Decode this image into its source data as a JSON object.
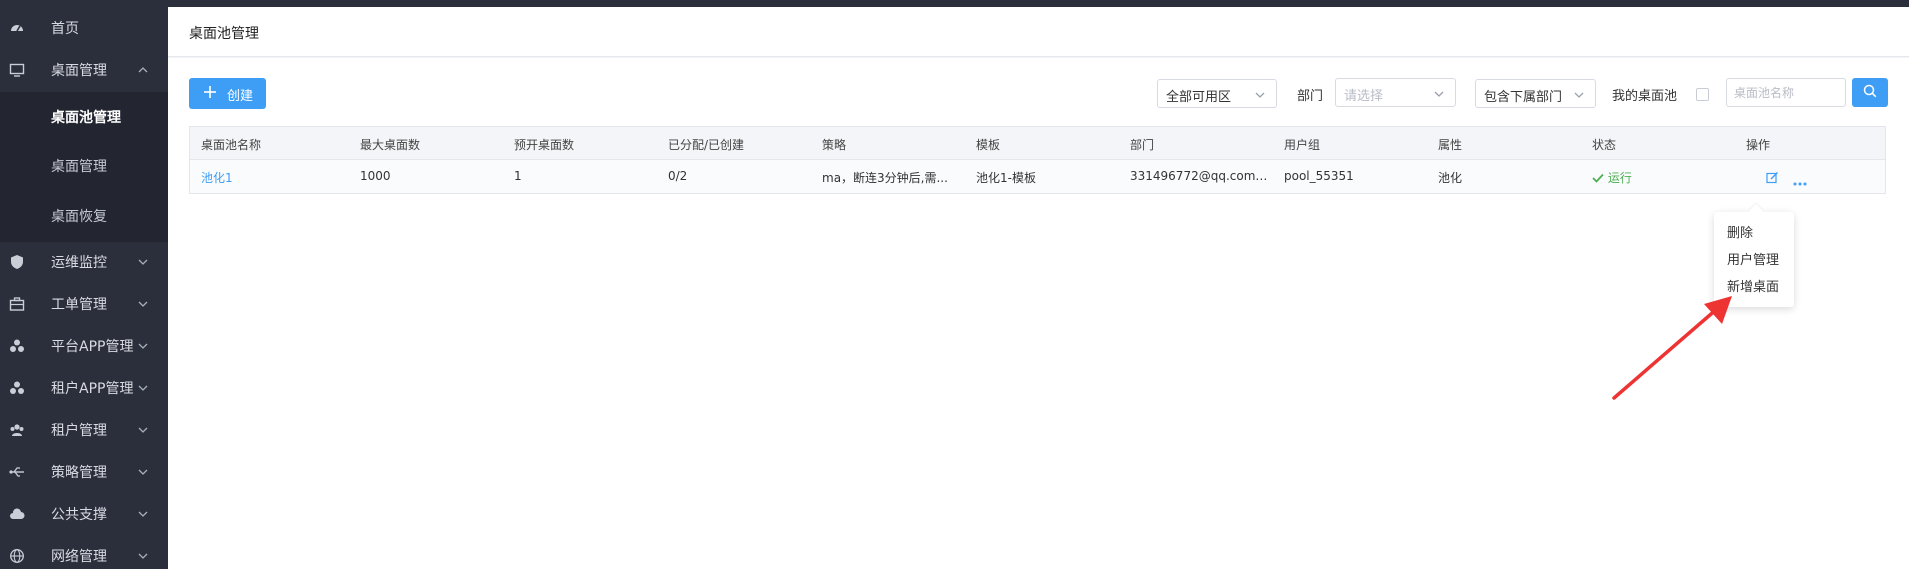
{
  "sidebar": {
    "items": [
      {
        "label": "首页",
        "icon": "dashboard-icon"
      },
      {
        "label": "桌面管理",
        "icon": "monitor-icon",
        "expanded": true
      },
      {
        "label": "运维监控",
        "icon": "shield-icon"
      },
      {
        "label": "工单管理",
        "icon": "briefcase-icon"
      },
      {
        "label": "平台APP管理",
        "icon": "apps-icon"
      },
      {
        "label": "租户APP管理",
        "icon": "apps-icon"
      },
      {
        "label": "租户管理",
        "icon": "users-icon"
      },
      {
        "label": "策略管理",
        "icon": "usb-icon"
      },
      {
        "label": "公共支撑",
        "icon": "cloud-icon"
      },
      {
        "label": "网络管理",
        "icon": "globe-icon"
      }
    ],
    "sub_items": [
      {
        "label": "桌面池管理",
        "active": true
      },
      {
        "label": "桌面管理"
      },
      {
        "label": "桌面恢复"
      }
    ]
  },
  "header": {
    "title": "桌面池管理"
  },
  "toolbar": {
    "create_label": "创建",
    "zone_select": "全部可用区",
    "dept_label": "部门",
    "dept_placeholder": "请选择",
    "include_sub_select": "包含下属部门",
    "my_pool_label": "我的桌面池",
    "my_pool_checked": false,
    "search_placeholder": "桌面池名称"
  },
  "table": {
    "columns": [
      "桌面池名称",
      "最大桌面数",
      "预开桌面数",
      "已分配/已创建",
      "策略",
      "模板",
      "部门",
      "用户组",
      "属性",
      "状态",
      "操作"
    ],
    "rows": [
      {
        "name": "池化1",
        "max": "1000",
        "preopen": "1",
        "alloc": "0/2",
        "policy": "ma，断连3分钟后,需...",
        "template": "池化1-模板",
        "dept": "331496772@qq.com#...",
        "group": "pool_55351",
        "attr": "池化",
        "status": "运行"
      }
    ]
  },
  "row_menu": [
    "删除",
    "用户管理",
    "新增桌面"
  ],
  "colors": {
    "accent": "#3e9ef6",
    "sidebar_bg": "#2b2f3c",
    "status_ok": "#4caf50",
    "annotation_arrow": "#ee3333"
  }
}
